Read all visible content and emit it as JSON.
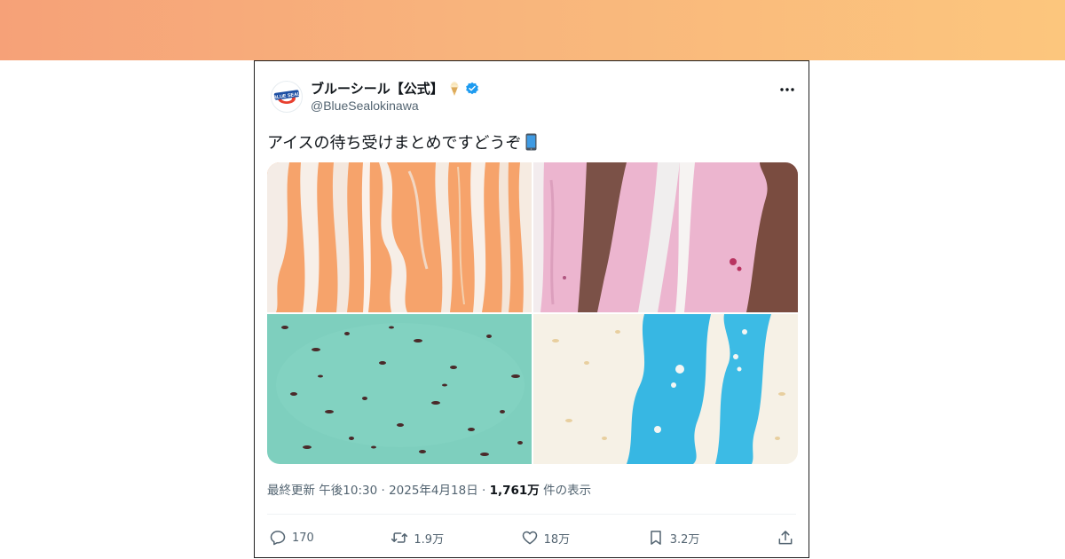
{
  "colors": {
    "banner_start": "#f6a178",
    "banner_end": "#fcc67d",
    "verified": "#1d9bf0",
    "muted_text": "#536471"
  },
  "tweet": {
    "display_name": "ブルーシール【公式】",
    "name_emoji": "ice-cream-icon",
    "verified_badge": "verified-badge-icon",
    "handle": "@BlueSealokinawa",
    "avatar_text": "BLUE SEAL",
    "text": "アイスの待ち受けまとめですどうぞ",
    "text_emoji": "mobile-phone-icon",
    "media": [
      {
        "name": "orange-swirl-ice-cream-image"
      },
      {
        "name": "pink-chocolate-vanilla-ice-cream-image"
      },
      {
        "name": "mint-chocolate-chip-ice-cream-image"
      },
      {
        "name": "blue-vanilla-swirl-ice-cream-image"
      }
    ],
    "meta": {
      "updated_prefix": "最終更新 午後10:30 · 2025年4月18日 · ",
      "views": "1,761万",
      "views_suffix": " 件の表示"
    },
    "actions": {
      "replies": "170",
      "retweets": "1.9万",
      "likes": "18万",
      "bookmarks": "3.2万"
    }
  }
}
